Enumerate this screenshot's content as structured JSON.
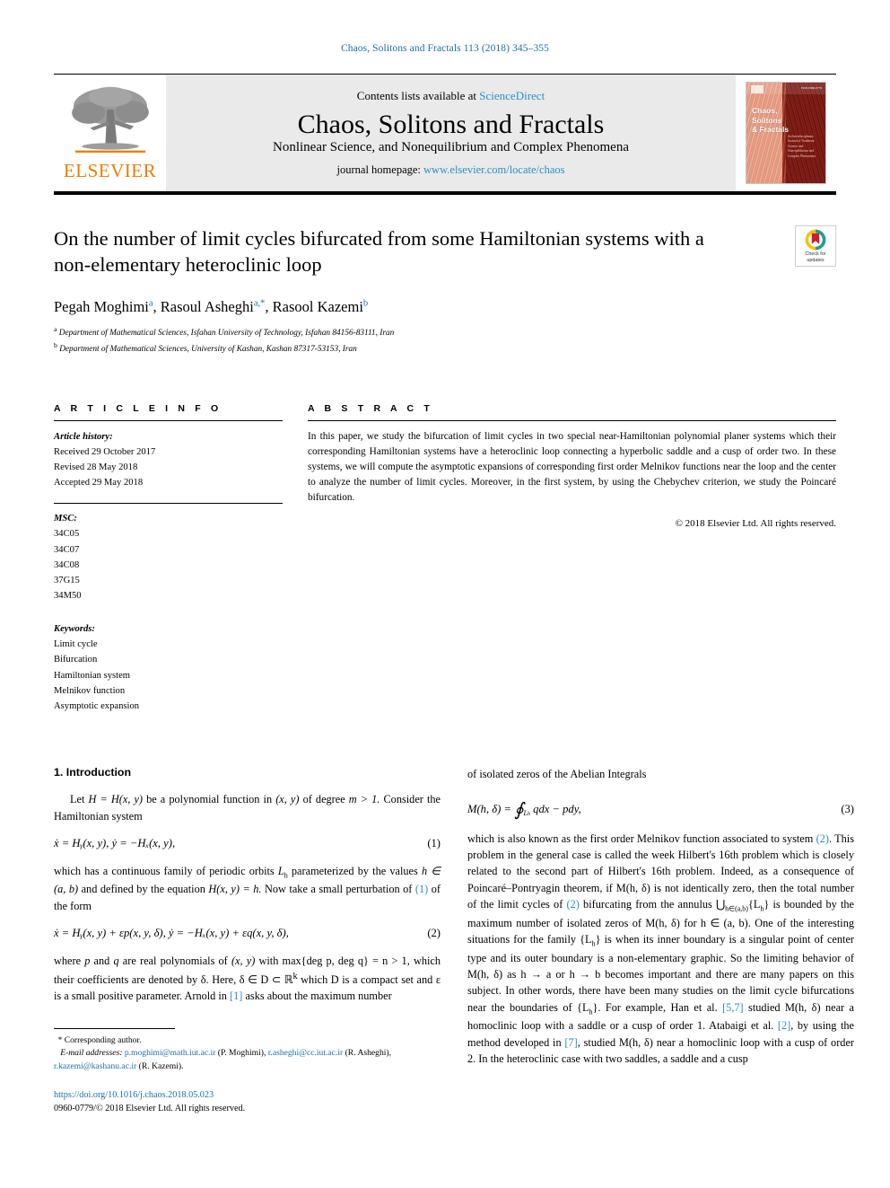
{
  "running_head": "Chaos, Solitons and Fractals 113 (2018) 345–355",
  "masthead": {
    "publisher_name": "ELSEVIER",
    "contents_prefix": "Contents lists available at",
    "contents_link": "ScienceDirect",
    "journal_title": "Chaos, Solitons and Fractals",
    "journal_subtitle": "Nonlinear Science, and Nonequilibrium and Complex Phenomena",
    "homepage_label": "journal homepage:",
    "homepage_url": "www.elsevier.com/locate/chaos",
    "cover": {
      "title_line1": "Chaos,",
      "title_line2": "Solitons",
      "title_line3": "& Fractals",
      "sub_lines": "An Interdisciplinary Journal of Nonlinear Science and Nonequilibrium and Complex Phenomena",
      "corner_text": "ISSN 0960-0779"
    }
  },
  "article": {
    "title": "On the number of limit cycles bifurcated from some Hamiltonian systems with a non-elementary heteroclinic loop",
    "authors_html": "Pegah Moghimi<sup>a</sup>, Rasoul Asheghi<sup>a,*</sup>, Rasool Kazemi<sup>b</sup>",
    "affiliations": [
      {
        "marker": "a",
        "text": "Department of Mathematical Sciences, Isfahan University of Technology, Isfahan 84156-83111, Iran"
      },
      {
        "marker": "b",
        "text": "Department of Mathematical Sciences, University of Kashan, Kashan 87317-53153, Iran"
      }
    ],
    "crossmark": {
      "line1": "Check for",
      "line2": "updates"
    }
  },
  "info": {
    "heading": "A R T I C L E   I N F O",
    "history_label": "Article history:",
    "history": [
      "Received 29 October 2017",
      "Revised 28 May 2018",
      "Accepted 29 May 2018"
    ],
    "msc_label": "MSC:",
    "msc": [
      "34C05",
      "34C07",
      "34C08",
      "37G15",
      "34M50"
    ],
    "keywords_label": "Keywords:",
    "keywords": [
      "Limit cycle",
      "Bifurcation",
      "Hamiltonian system",
      "Melnikov function",
      "Asymptotic expansion"
    ]
  },
  "abstract": {
    "heading": "A B S T R A C T",
    "text": "In this paper, we study the bifurcation of limit cycles in two special near-Hamiltonian polynomial planer systems which their corresponding Hamiltonian systems have a heteroclinic loop connecting a hyperbolic saddle and a cusp of order two. In these systems, we will compute the asymptotic expansions of corresponding first order Melnikov functions near the loop and the center to analyze the number of limit cycles. Moreover, in the first system, by using the Chebychev criterion, we study the Poincaré bifurcation.",
    "copyright": "© 2018 Elsevier Ltd. All rights reserved."
  },
  "body": {
    "section_heading": "1. Introduction",
    "left": {
      "p1_a": "Let ",
      "p1_math1": "H = H(x, y)",
      "p1_b": " be a polynomial function in ",
      "p1_math2": "(x, y)",
      "p1_c": " of degree ",
      "p1_math3": "m > 1.",
      "p1_d": " Consider the Hamiltonian system",
      "eq1_body": "ẋ = H",
      "eq1_full": "ẋ = Hᵧ(x, y),    ẏ = −Hₓ(x, y),",
      "eq1_num": "(1)",
      "p2_a": "which has a continuous family of periodic orbits ",
      "p2_Lh": "L",
      "p2_b": " parameterized by the values ",
      "p2_hab": "h ∈ (a, b)",
      "p2_c": " and defined by the equation ",
      "p2_Hxy": "H(x, y) = h.",
      "p2_d": " Now take a small perturbation of ",
      "p2_ref": "(1)",
      "p2_e": " of the form",
      "eq2_full": "ẋ = Hᵧ(x, y) + εp(x, y, δ),    ẏ = −Hₓ(x, y) + εq(x, y, δ),",
      "eq2_num": "(2)",
      "p3_a": "where ",
      "p3_p": "p",
      "p3_b": " and ",
      "p3_q": "q",
      "p3_c": " are real polynomials of ",
      "p3_xy": "(x, y)",
      "p3_d": " with max{deg p, deg q} = n > 1, which their coefficients are denoted by δ. Here, δ ∈ D ⊂ ℝ",
      "p3_k": "k",
      "p3_e": " which D is a compact set and ε is a small positive parameter. Arnold in ",
      "p3_ref": "[1]",
      "p3_f": " asks about the maximum number"
    },
    "right": {
      "p1": "of isolated zeros of the Abelian Integrals",
      "eq3_lhs": "M(h, δ) = ",
      "eq3_int_sub": "L",
      "eq3_rhs": "qdx − pdy,",
      "eq3_num": "(3)",
      "p2_a": "which is also known as the first order Melnikov function associated to system ",
      "p2_ref1": "(2)",
      "p2_b": ". This problem in the general case is called the week Hilbert's 16th problem which is closely related to the second part of Hilbert's 16th problem. Indeed, as a consequence of Poincaré–Pontryagin theorem, if M(h, δ) is not identically zero, then the total number of the limit cycles of ",
      "p2_ref2": "(2)",
      "p2_c": " bifurcating from the annulus ⋃",
      "p2_annulus_sub": "h∈(a,b)",
      "p2_d": "{L",
      "p2_e": "} is bounded by the maximum number of isolated zeros of M(h, δ) for h ∈ (a, b). One of the interesting situations for the family {L",
      "p2_f": "} is when its inner boundary is a singular point of center type and its outer boundary is a non-elementary graphic. So the limiting behavior of M(h, δ) as h → a or h → b becomes important and there are many papers on this subject. In other words, there have been many studies on the limit cycle bifurcations near the boundaries of {L",
      "p2_g": "}. For example, Han et al. ",
      "p2_ref3": "[5,7]",
      "p2_h": " studied M(h, δ) near a homoclinic loop with a saddle or a cusp of order 1. Atabaigi et al. ",
      "p2_ref4": "[2]",
      "p2_i": ", by using the method developed in ",
      "p2_ref5": "[7]",
      "p2_j": ", studied M(h, δ) near a homoclinic loop with a cusp of order 2. In the heteroclinic case with two saddles, a saddle and a cusp"
    }
  },
  "footnote": {
    "star": "*",
    "corresponding": "Corresponding author.",
    "email_label": "E-mail addresses:",
    "emails": [
      {
        "address": "p.moghimi@math.iut.ac.ir",
        "who": "(P. Moghimi)"
      },
      {
        "address": "r.asheghi@cc.iut.ac.ir",
        "who": "(R. Asheghi)"
      },
      {
        "address": "r.kazemi@kashanu.ac.ir",
        "who": "(R. Kazemi)"
      }
    ]
  },
  "doi_block": {
    "doi": "https://doi.org/10.1016/j.chaos.2018.05.023",
    "issn_line": "0960-0779/© 2018 Elsevier Ltd. All rights reserved."
  },
  "colors": {
    "link_blue": "#2a8fc4",
    "header_blue": "#1a6fa8",
    "elsevier_orange": "#f07c00",
    "masthead_grey": "#eaeaea"
  }
}
